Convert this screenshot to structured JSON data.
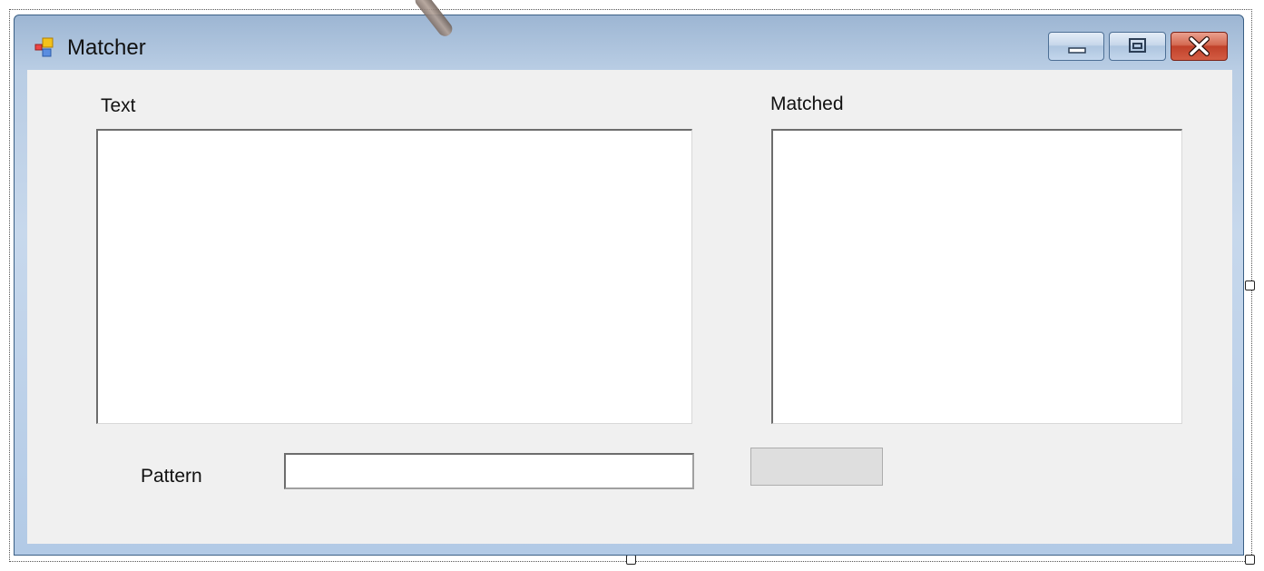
{
  "window": {
    "title": "Matcher",
    "icon": "winforms-app-icon",
    "controls": {
      "minimize": "minimize-icon",
      "maximize": "restore-icon",
      "close": "close-icon"
    }
  },
  "form": {
    "text_label": "Text",
    "matched_label": "Matched",
    "pattern_label": "Pattern",
    "text_value": "",
    "matched_value": "",
    "pattern_value": "",
    "match_button_label": ""
  },
  "colors": {
    "client_background": "#f0f0f0",
    "titlebar": "#b9cde4",
    "close_button": "#c0412a"
  }
}
